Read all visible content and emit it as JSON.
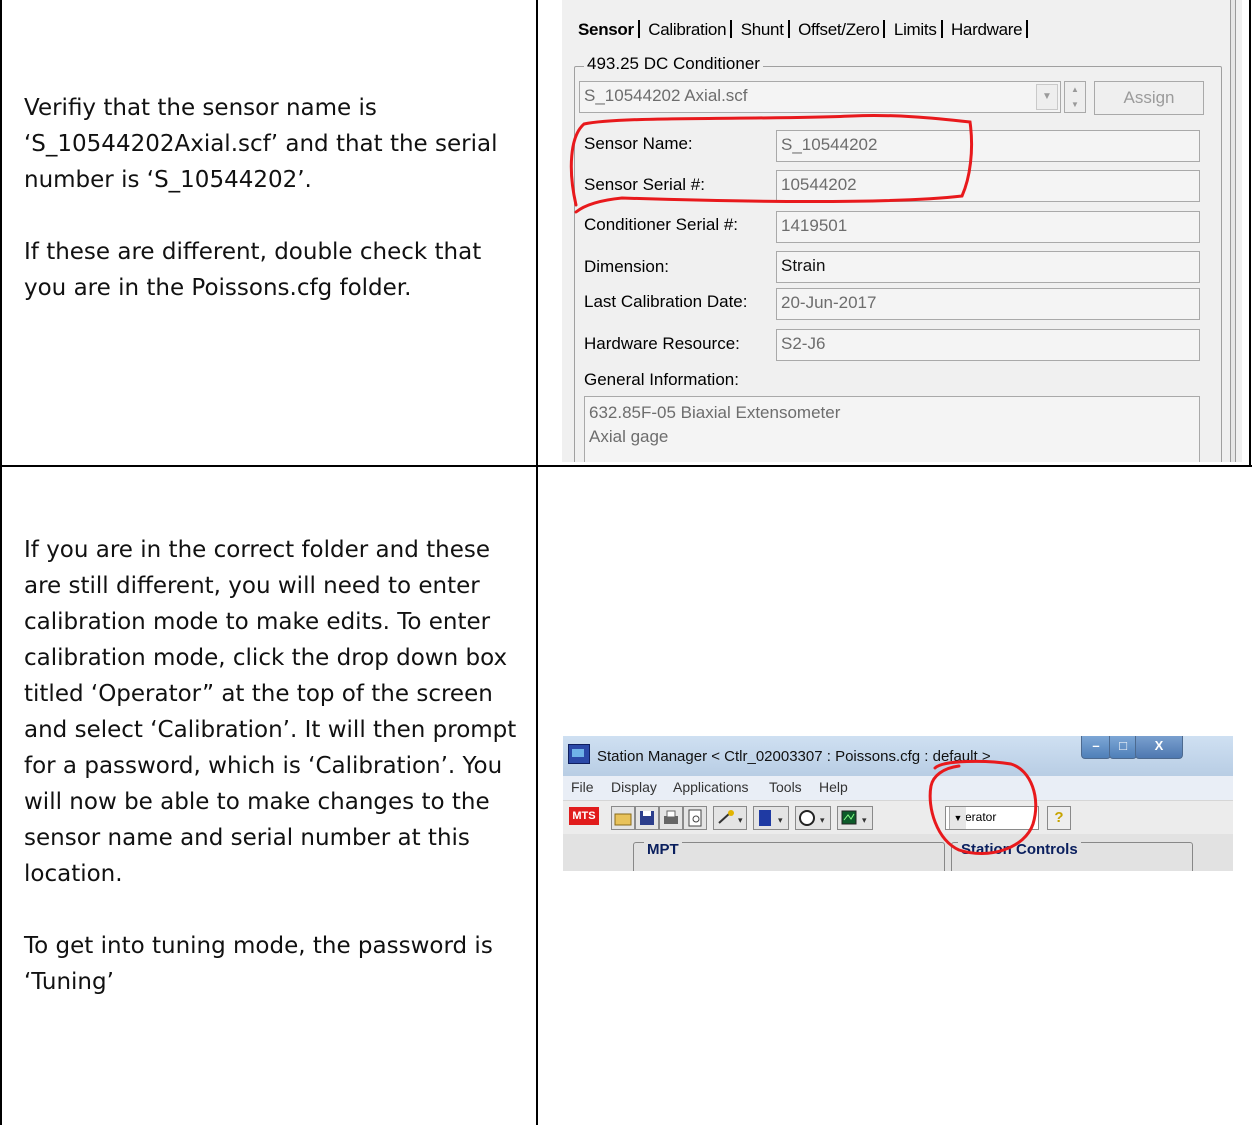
{
  "instructions": {
    "row1": [
      "Verifiy that the sensor name is ‘S_10544202Axial.scf’ and that the serial number is ‘S_10544202’.",
      "If these are different, double check that you are in the Poissons.cfg folder."
    ],
    "row2": [
      "If you are in the correct folder and these are still different, you will need to enter calibration mode to make edits. To enter calibration mode, click the drop down box titled ‘Operator” at the top of the screen and select ‘Calibration’. It will then prompt for a password, which is ‘Calibration’. You will now be able to make changes to the sensor name and serial number at this location.",
      "To get into tuning mode, the password is ‘Tuning’"
    ]
  },
  "sensor_dialog": {
    "tabs": [
      "Sensor",
      "Calibration",
      "Shunt",
      "Offset/Zero",
      "Limits",
      "Hardware"
    ],
    "active_tab": "Sensor",
    "group_title": "493.25 DC Conditioner",
    "sensor_file": "S_10544202 Axial.scf",
    "assign_label": "Assign",
    "fields": [
      {
        "label": "Sensor Name:",
        "value": "S_10544202"
      },
      {
        "label": "Sensor Serial #:",
        "value": "10544202"
      },
      {
        "label": "Conditioner Serial #:",
        "value": "1419501"
      },
      {
        "label": "Dimension:",
        "value": "Strain"
      },
      {
        "label": "Last Calibration Date:",
        "value": "20-Jun-2017"
      },
      {
        "label": "Hardware Resource:",
        "value": "S2-J6"
      }
    ],
    "general_info_label": "General Information:",
    "general_info_lines": [
      "632.85F-05 Biaxial Extensometer",
      "Axial gage"
    ],
    "highlight_color": "#e8191c"
  },
  "station_manager": {
    "window_title": "Station Manager < Ctlr_02003307 : Poissons.cfg : default >",
    "menu": [
      "File",
      "Display",
      "Applications",
      "Tools",
      "Help"
    ],
    "logo": "MTS",
    "role_value": "Operator",
    "help_icon": "question-icon",
    "panel_left_title": "MPT",
    "panel_right_title": "Station Controls",
    "window_buttons": [
      "minimize-icon",
      "maximize-icon",
      "close-icon"
    ],
    "close_glyph": "X"
  }
}
